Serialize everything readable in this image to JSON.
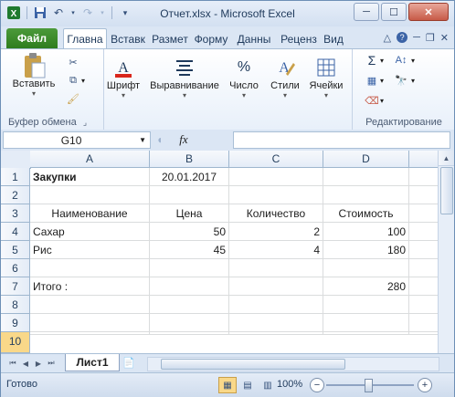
{
  "window": {
    "title": "Отчет.xlsx - Microsoft Excel",
    "minimize_label": "─",
    "maximize_label": "☐",
    "close_label": "✕"
  },
  "quick_access": {
    "app_icon": "excel-logo",
    "save_icon": "floppy-disk",
    "undo_icon": "undo-arrow",
    "redo_icon": "redo-arrow"
  },
  "ribbon_tabs": {
    "file": "Файл",
    "items": [
      "Главна",
      "Вставк",
      "Размет",
      "Форму",
      "Данны",
      "Реценз",
      "Вид"
    ]
  },
  "ribbon": {
    "paste_label": "Вставить",
    "clipboard_group": "Буфер обмена",
    "font_label": "Шрифт",
    "alignment_label": "Выравнивание",
    "number_label": "Число",
    "styles_label": "Стили",
    "cells_label": "Ячейки",
    "editing_group": "Редактирование"
  },
  "formula_bar": {
    "name_box": "G10",
    "fx_label": "fx",
    "formula": ""
  },
  "sheet": {
    "columns": [
      "A",
      "B",
      "C",
      "D"
    ],
    "rows": [
      "1",
      "2",
      "3",
      "4",
      "5",
      "6",
      "7",
      "8",
      "9",
      "10"
    ],
    "selected_row": "10",
    "cells": {
      "A1": "Закупки",
      "B1": "20.01.2017",
      "A3": "Наименование",
      "B3": "Цена",
      "C3": "Количество",
      "D3": "Стоимость",
      "A4": "Сахар",
      "B4": "50",
      "C4": "2",
      "D4": "100",
      "A5": "Рис",
      "B5": "45",
      "C5": "4",
      "D5": "180",
      "A7": "Итого :",
      "D7": "280"
    }
  },
  "sheet_tabs": {
    "active": "Лист1"
  },
  "status_bar": {
    "status": "Готово",
    "zoom": "100%"
  },
  "colors": {
    "file_tab": "#2e7d1e",
    "selected_row_header": "#f9d889",
    "window_frame": "#dbe6f4"
  }
}
